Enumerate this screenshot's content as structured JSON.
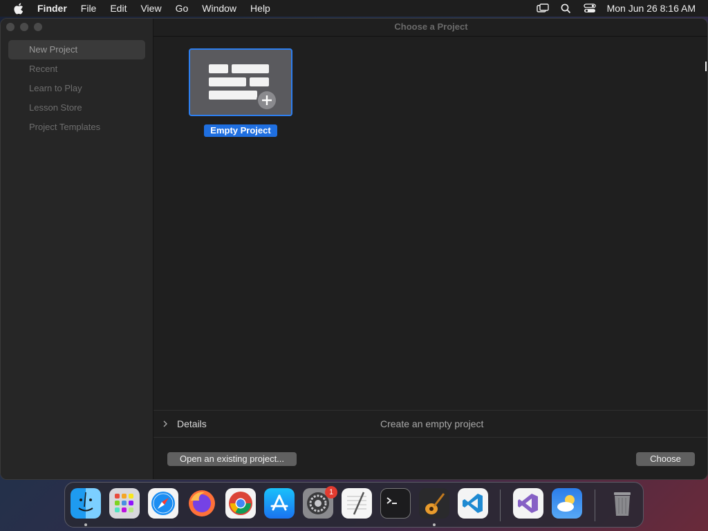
{
  "menubar": {
    "app": "Finder",
    "items": [
      "File",
      "Edit",
      "View",
      "Go",
      "Window",
      "Help"
    ],
    "clock": "Mon Jun 26  8:16 AM",
    "icons": [
      "screen-mirroring-icon",
      "search-icon",
      "control-center-icon"
    ]
  },
  "window": {
    "title": "Choose a Project",
    "sidebar": {
      "items": [
        "New Project",
        "Recent",
        "Learn to Play",
        "Lesson Store",
        "Project Templates"
      ],
      "selected": "New Project"
    },
    "template": {
      "label": "Empty Project",
      "icon": "empty-project-icon"
    },
    "details": {
      "label": "Details",
      "description": "Create an empty project"
    },
    "buttons": {
      "open_existing": "Open an existing project...",
      "choose": "Choose"
    }
  },
  "dock": {
    "apps": [
      "finder",
      "launchpad",
      "safari",
      "firefox",
      "chrome",
      "app-store",
      "system-settings",
      "textedit",
      "terminal",
      "garageband",
      "vscode",
      "visual-studio",
      "weather",
      "trash"
    ],
    "badges": {
      "system-settings": "1"
    }
  },
  "colors": {
    "accent": "#1f6fe0",
    "badge": "#e23b30"
  }
}
